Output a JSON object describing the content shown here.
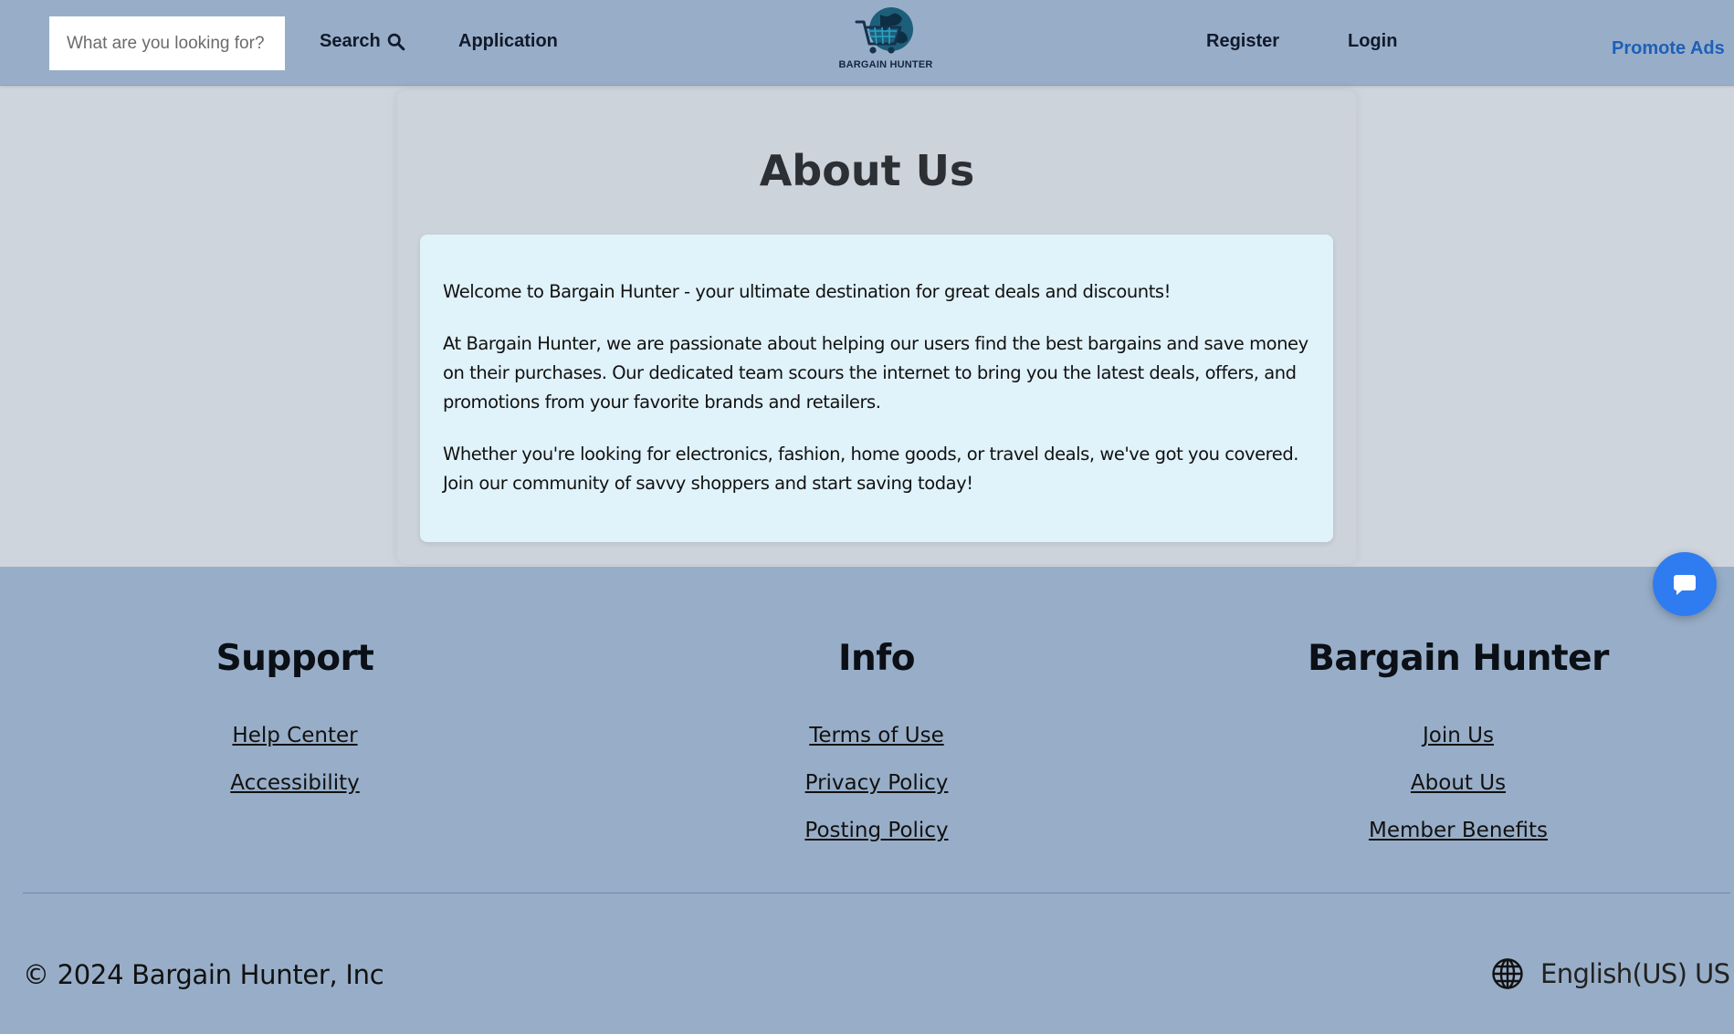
{
  "header": {
    "search_placeholder": "What are you looking for?",
    "search_label": "Search",
    "application_label": "Application",
    "logo_text": "BARGAIN HUNTER",
    "register_label": "Register",
    "login_label": "Login",
    "promote_label": "Promote Ads"
  },
  "main": {
    "title": "About Us",
    "paragraphs": [
      "Welcome to Bargain Hunter - your ultimate destination for great deals and discounts!",
      "At Bargain Hunter, we are passionate about helping our users find the best bargains and save money on their purchases. Our dedicated team scours the internet to bring you the latest deals, offers, and promotions from your favorite brands and retailers.",
      "Whether you're looking for electronics, fashion, home goods, or travel deals, we've got you covered. Join our community of savvy shoppers and start saving today!"
    ]
  },
  "footer": {
    "columns": [
      {
        "heading": "Support",
        "links": [
          "Help Center",
          "Accessibility"
        ]
      },
      {
        "heading": "Info",
        "links": [
          "Terms of Use",
          "Privacy Policy",
          "Posting Policy"
        ]
      },
      {
        "heading": "Bargain Hunter",
        "links": [
          "Join Us",
          "About Us",
          "Member Benefits"
        ]
      }
    ],
    "copyright": "© 2024 Bargain Hunter, Inc",
    "language": "English(US) US $"
  },
  "icons": {
    "search": "search-icon",
    "globe": "globe-icon",
    "chat": "chat-bubble-icon",
    "logo": "cart-globe-logo"
  },
  "colors": {
    "header_bg": "#98aec8",
    "page_bg": "#cfd5dd",
    "about_box_bg": "#e0f2fa",
    "promote_link": "#1f5fb8",
    "chat_button": "#2f7cf0"
  }
}
